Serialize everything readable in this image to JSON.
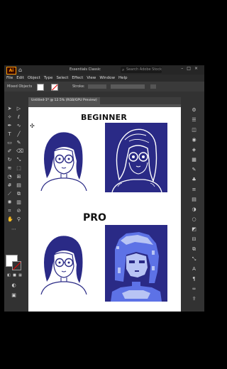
{
  "app": {
    "logo": "Ai",
    "workspace": "Essentials Classic",
    "search_placeholder": "Search Adobe Stock"
  },
  "menu": [
    "File",
    "Edit",
    "Object",
    "Type",
    "Select",
    "Effect",
    "View",
    "Window",
    "Help"
  ],
  "control_bar": {
    "selection_label": "Mixed Objects",
    "stroke_label": "Stroke:"
  },
  "document_tab": "Untitled-1* @ 12.5% (RGB/GPU Preview)",
  "artboard": {
    "heading_beginner": "BEGINNER",
    "heading_pro": "PRO"
  },
  "colors": {
    "accent_orange": "#ff9a00",
    "portrait_blue": "#2a2a86",
    "pro_highlight": "#5d72e6",
    "pro_light": "#b8c4f4"
  },
  "icons": {
    "left_tools": [
      "selection-arrow",
      "direct-selection-arrow",
      "magic-wand",
      "lasso",
      "pen",
      "curvature",
      "type",
      "line-segment",
      "rectangle",
      "paintbrush",
      "shaper",
      "eraser",
      "rotate",
      "scale",
      "width",
      "free-transform",
      "shape-builder",
      "perspective-grid",
      "mesh",
      "gradient",
      "eyedropper",
      "blend",
      "symbol-sprayer",
      "column-graph",
      "artboard",
      "slice",
      "hand",
      "zoom"
    ],
    "right_panels": [
      "properties",
      "layers",
      "libraries",
      "color",
      "color-guide",
      "swatches",
      "brushes",
      "symbols",
      "stroke",
      "gradient",
      "transparency",
      "appearance",
      "graphic-styles",
      "align",
      "pathfinder",
      "transform",
      "character",
      "paragraph",
      "links",
      "asset-export"
    ]
  }
}
